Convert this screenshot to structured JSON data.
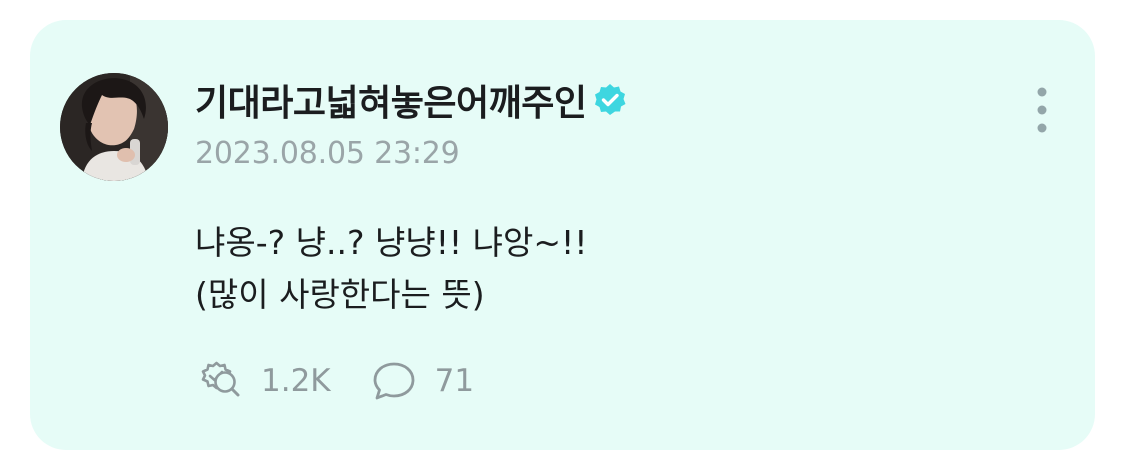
{
  "post": {
    "author": "기대라고넓혀놓은어깨주인",
    "verified": true,
    "timestamp": "2023.08.05 23:29",
    "text_lines": [
      "냐옹-? 냥..? 냥냥!! 냐앙~!!",
      "(많이 사랑한다는 뜻)"
    ],
    "repost_count": "1.2K",
    "comment_count": "71"
  },
  "colors": {
    "card_background": "#e6fcf7",
    "verified_badge": "#3ed6e0",
    "muted_text": "#9aa5a8"
  },
  "icons": {
    "verified": "verified-badge-icon",
    "more": "more-vertical-icon",
    "repost": "repost-icon",
    "comment": "comment-icon"
  }
}
